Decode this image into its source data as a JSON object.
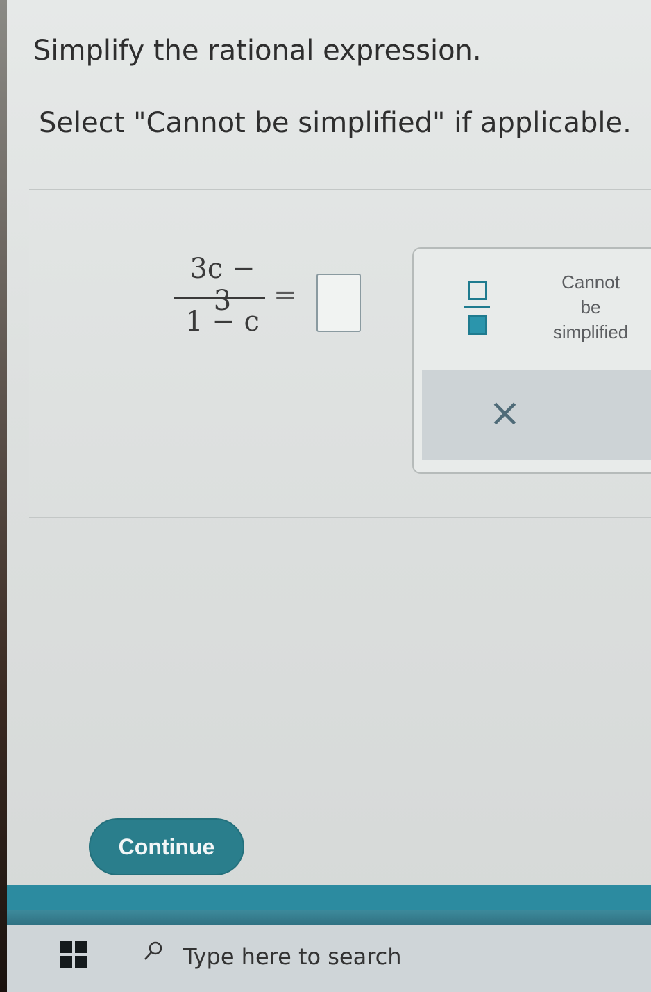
{
  "instructions": {
    "line1": "Simplify the rational expression.",
    "line2": "Select \"Cannot be simplified\" if applicable."
  },
  "expression": {
    "numerator": "3c − 3",
    "denominator": "1 − c",
    "equals": "="
  },
  "keypad": {
    "cannot_line1": "Cannot",
    "cannot_line2": "be",
    "cannot_line3": "simplified",
    "clear_symbol": "×"
  },
  "continue_label": "Continue",
  "taskbar": {
    "search_placeholder": "Type here to search"
  },
  "colors": {
    "accent": "#2a7e8c",
    "keypad_icon": "#1f7b8f",
    "clear_bg": "#cdd3d6"
  }
}
